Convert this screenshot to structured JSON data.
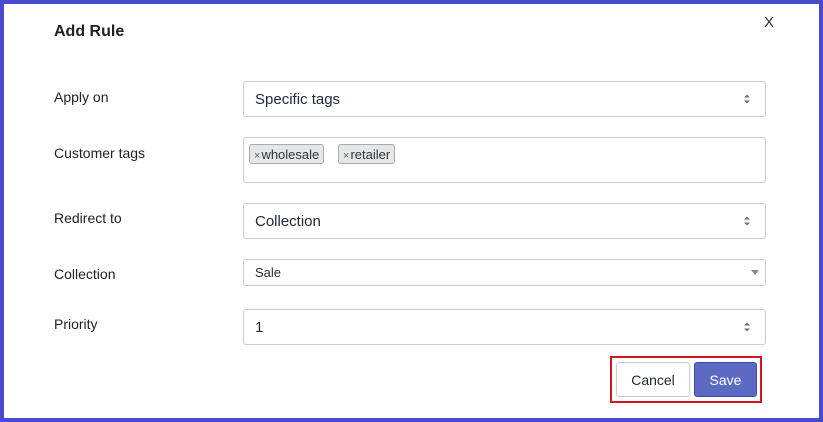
{
  "dialog": {
    "title": "Add Rule",
    "close_label": "X"
  },
  "form": {
    "apply_on": {
      "label": "Apply on",
      "value": "Specific tags"
    },
    "customer_tags": {
      "label": "Customer tags",
      "tags": [
        "wholesale",
        "retailer"
      ],
      "remove_glyph": "×"
    },
    "redirect_to": {
      "label": "Redirect to",
      "value": "Collection"
    },
    "collection": {
      "label": "Collection",
      "value": "Sale"
    },
    "priority": {
      "label": "Priority",
      "value": "1"
    }
  },
  "footer": {
    "cancel_label": "Cancel",
    "save_label": "Save"
  },
  "colors": {
    "backdrop": "#4a4ad0",
    "primary": "#5c6ac4",
    "highlight": "#d0161f"
  }
}
